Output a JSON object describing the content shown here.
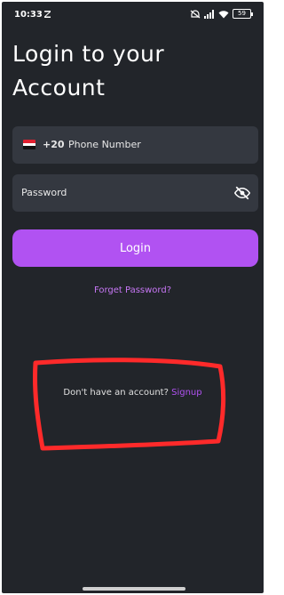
{
  "status_bar": {
    "time": "10:33",
    "notification_icon": "message-icon",
    "icons": [
      "muted-icon",
      "signal-icon",
      "wifi-icon",
      "battery-icon"
    ],
    "battery": "59"
  },
  "title": "Login to your Account",
  "phone_field": {
    "flag": "egypt-flag",
    "dial_code": "+20",
    "placeholder": "Phone Number"
  },
  "password_field": {
    "placeholder": "Password",
    "visibility_icon": "eye-off-icon"
  },
  "login_button": {
    "label": "Login"
  },
  "forgot_password": {
    "label": "Forget Password?"
  },
  "signup": {
    "prompt": "Don't have an account?",
    "link": "Signup"
  },
  "colors": {
    "background": "#22252a",
    "field": "#343840",
    "accent": "#b152f2",
    "annotation": "#ff2a2a"
  }
}
